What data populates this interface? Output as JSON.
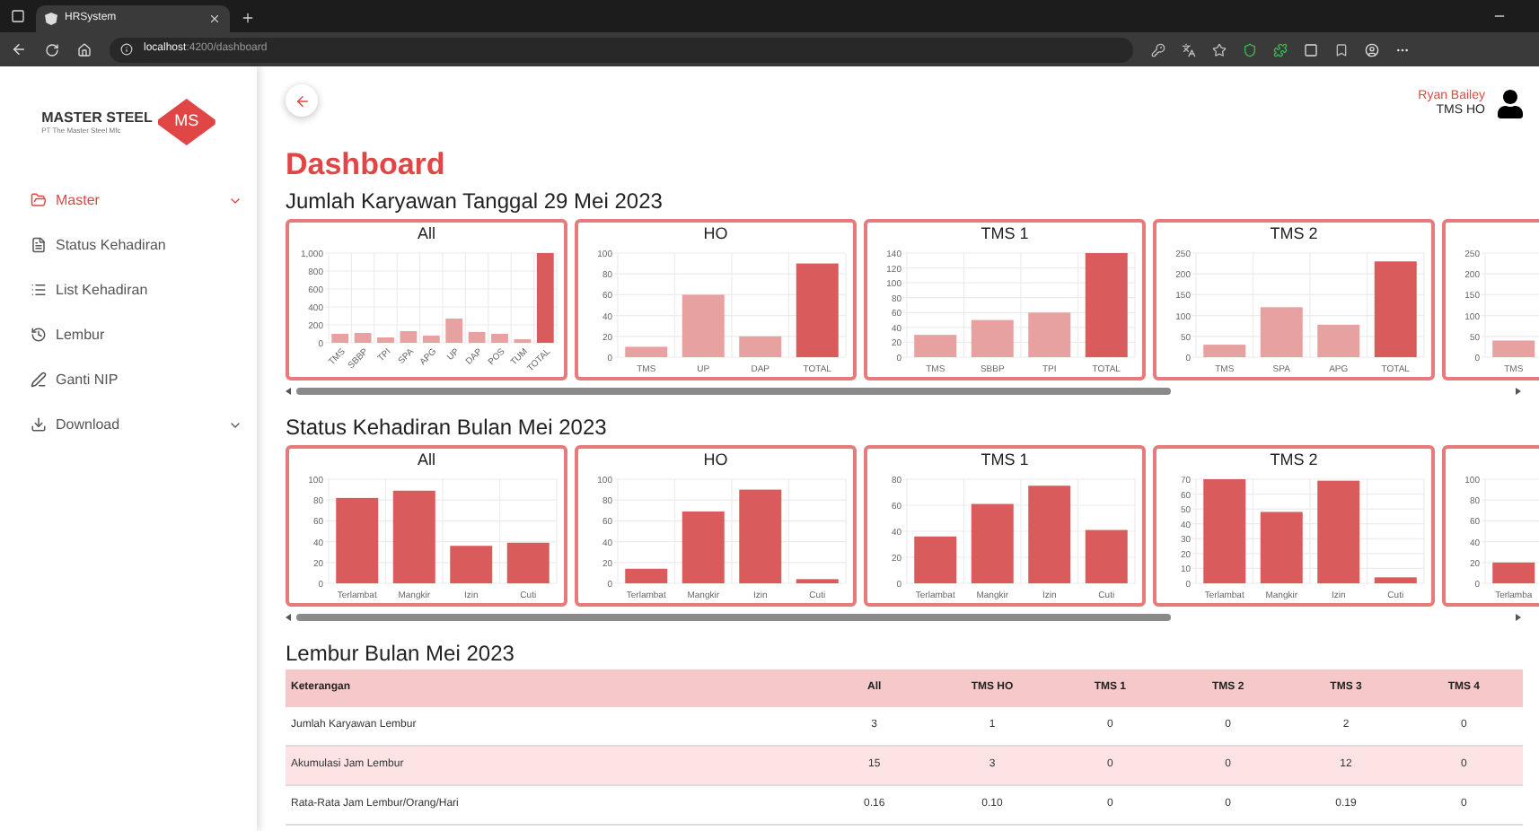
{
  "browser": {
    "tab_title": "HRSystem",
    "url_host": "localhost",
    "url_path": ":4200/dashboard"
  },
  "sidebar": {
    "logo": {
      "brand": "MASTER STEEL",
      "badge": "MS",
      "company": "PT The Master Steel Mfc"
    },
    "items": [
      {
        "label": "Master",
        "selected": true,
        "has_submenu": true
      },
      {
        "label": "Status Kehadiran",
        "selected": false,
        "has_submenu": false
      },
      {
        "label": "List Kehadiran",
        "selected": false,
        "has_submenu": false
      },
      {
        "label": "Lembur",
        "selected": false,
        "has_submenu": false
      },
      {
        "label": "Ganti NIP",
        "selected": false,
        "has_submenu": false
      },
      {
        "label": "Download",
        "selected": false,
        "has_submenu": true
      }
    ]
  },
  "user": {
    "name": "Ryan Bailey",
    "unit": "TMS HO"
  },
  "page_title": "Dashboard",
  "employee_section": {
    "title": "Jumlah Karyawan Tanggal 29 Mei 2023",
    "charts": [
      {
        "chart_data": {
          "type": "bar",
          "title": "All",
          "categories": [
            "TMS",
            "SBBP",
            "TPI",
            "SPA",
            "APG",
            "UP",
            "DAP",
            "POS",
            "TUM",
            "TOTAL"
          ],
          "grid": true,
          "ylim": [
            0,
            1000
          ],
          "yticks": [
            0,
            200,
            400,
            600,
            800,
            {
              "value": 1000,
              "label": "1,000"
            }
          ],
          "series": [
            {
              "color": "#e8a1a1",
              "values": [
                100,
                110,
                60,
                130,
                80,
                270,
                120,
                100,
                40,
                null
              ]
            },
            {
              "color": "#d95b5b",
              "values": [
                null,
                null,
                null,
                null,
                null,
                null,
                null,
                null,
                null,
                1000
              ]
            }
          ]
        }
      },
      {
        "chart_data": {
          "type": "bar",
          "title": "HO",
          "categories": [
            "TMS",
            "UP",
            "DAP",
            "TOTAL"
          ],
          "grid": true,
          "ylim": [
            0,
            100
          ],
          "yticks": [
            0,
            20,
            40,
            60,
            80,
            100
          ],
          "series": [
            {
              "color": "#e8a1a1",
              "values": [
                10,
                60,
                20,
                null
              ]
            },
            {
              "color": "#d95b5b",
              "values": [
                null,
                null,
                null,
                90
              ]
            }
          ]
        }
      },
      {
        "chart_data": {
          "type": "bar",
          "title": "TMS 1",
          "categories": [
            "TMS",
            "SBBP",
            "TPI",
            "TOTAL"
          ],
          "grid": true,
          "ylim": [
            0,
            140
          ],
          "yticks": [
            0,
            20,
            40,
            60,
            80,
            100,
            120,
            140
          ],
          "series": [
            {
              "color": "#e8a1a1",
              "values": [
                30,
                50,
                60,
                null
              ]
            },
            {
              "color": "#d95b5b",
              "values": [
                null,
                null,
                null,
                140
              ]
            }
          ]
        }
      },
      {
        "chart_data": {
          "type": "bar",
          "title": "TMS 2",
          "categories": [
            "TMS",
            "SPA",
            "APG",
            "TOTAL"
          ],
          "grid": true,
          "ylim": [
            0,
            250
          ],
          "yticks": [
            0,
            50,
            100,
            150,
            200,
            250
          ],
          "series": [
            {
              "color": "#e8a1a1",
              "values": [
                30,
                120,
                78,
                null
              ]
            },
            {
              "color": "#d95b5b",
              "values": [
                null,
                null,
                null,
                230
              ]
            }
          ]
        }
      },
      {
        "chart_data": {
          "type": "bar",
          "categories": [
            "TMS"
          ],
          "grid": true,
          "ylim": [
            0,
            250
          ],
          "yticks": [
            0,
            50,
            100,
            150,
            200,
            250
          ],
          "series": [
            {
              "color": "#e8a1a1",
              "values": [
                40
              ]
            }
          ]
        }
      }
    ]
  },
  "attendance_section": {
    "title": "Status Kehadiran Bulan Mei 2023",
    "charts": [
      {
        "chart_data": {
          "type": "bar",
          "title": "All",
          "categories": [
            "Terlambat",
            "Mangkir",
            "Izin",
            "Cuti"
          ],
          "grid": true,
          "ylim": [
            0,
            100
          ],
          "yticks": [
            0,
            20,
            40,
            60,
            80,
            100
          ],
          "series": [
            {
              "color": "#d95b5b",
              "values": [
                82,
                89,
                36,
                39
              ]
            }
          ]
        }
      },
      {
        "chart_data": {
          "type": "bar",
          "title": "HO",
          "categories": [
            "Terlambat",
            "Mangkir",
            "Izin",
            "Cuti"
          ],
          "grid": true,
          "ylim": [
            0,
            100
          ],
          "yticks": [
            0,
            20,
            40,
            60,
            80,
            100
          ],
          "series": [
            {
              "color": "#d95b5b",
              "values": [
                14,
                69,
                90,
                4
              ]
            }
          ]
        }
      },
      {
        "chart_data": {
          "type": "bar",
          "title": "TMS 1",
          "categories": [
            "Terlambat",
            "Mangkir",
            "Izin",
            "Cuti"
          ],
          "grid": true,
          "ylim": [
            0,
            80
          ],
          "yticks": [
            0,
            20,
            40,
            60,
            80
          ],
          "series": [
            {
              "color": "#d95b5b",
              "values": [
                36,
                61,
                75,
                41
              ]
            }
          ]
        }
      },
      {
        "chart_data": {
          "type": "bar",
          "title": "TMS 2",
          "categories": [
            "Terlambat",
            "Mangkir",
            "Izin",
            "Cuti"
          ],
          "grid": true,
          "ylim": [
            0,
            70
          ],
          "yticks": [
            0,
            10,
            20,
            30,
            40,
            50,
            60,
            70
          ],
          "series": [
            {
              "color": "#d95b5b",
              "values": [
                70,
                48,
                69,
                4
              ]
            }
          ]
        }
      },
      {
        "chart_data": {
          "type": "bar",
          "categories": [
            "Terlamba"
          ],
          "grid": true,
          "ylim": [
            0,
            100
          ],
          "yticks": [
            0,
            20,
            40,
            60,
            80,
            100
          ],
          "series": [
            {
              "color": "#d95b5b",
              "values": [
                20
              ]
            }
          ]
        }
      }
    ]
  },
  "overtime_section": {
    "title": "Lembur Bulan Mei 2023",
    "table": {
      "columns": [
        "Keterangan",
        "All",
        "TMS HO",
        "TMS 1",
        "TMS 2",
        "TMS 3",
        "TMS 4"
      ],
      "rows": [
        {
          "highlighted": false,
          "cells": [
            "Jumlah Karyawan Lembur",
            "3",
            "1",
            "0",
            "0",
            "2",
            "0"
          ]
        },
        {
          "highlighted": true,
          "cells": [
            "Akumulasi Jam Lembur",
            "15",
            "3",
            "0",
            "0",
            "12",
            "0"
          ]
        },
        {
          "highlighted": false,
          "cells": [
            "Rata-Rata Jam Lembur/Orang/Hari",
            "0.16",
            "0.10",
            "0",
            "0",
            "0.19",
            "0"
          ]
        }
      ]
    }
  }
}
